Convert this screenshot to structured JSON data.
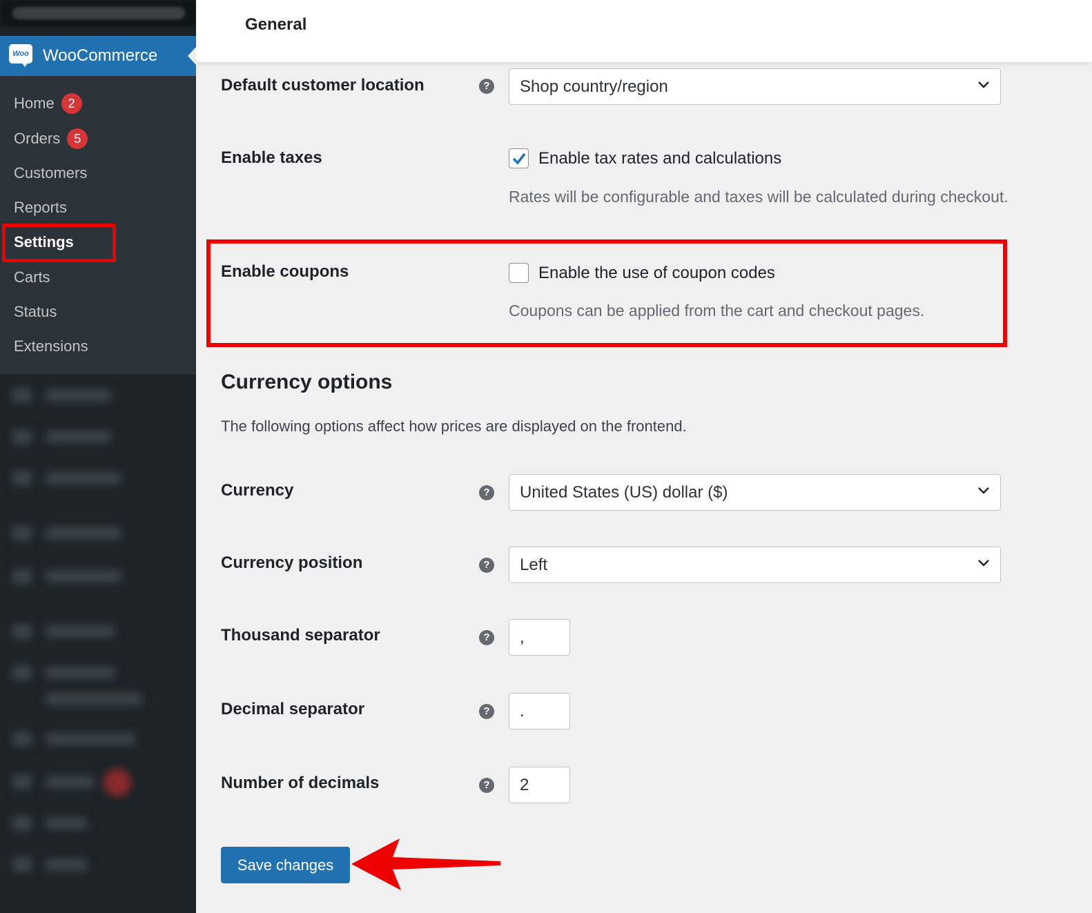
{
  "sidebar": {
    "brand": "WooCommerce",
    "logo_text": "Woo",
    "items": [
      {
        "label": "Home",
        "badge": "2"
      },
      {
        "label": "Orders",
        "badge": "5"
      },
      {
        "label": "Customers"
      },
      {
        "label": "Reports"
      },
      {
        "label": "Settings",
        "active": true
      },
      {
        "label": "Carts"
      },
      {
        "label": "Status"
      },
      {
        "label": "Extensions"
      }
    ]
  },
  "header": {
    "title": "General"
  },
  "fields": {
    "default_location": {
      "label": "Default customer location",
      "value": "Shop country/region"
    },
    "enable_taxes": {
      "label": "Enable taxes",
      "checkbox_label": "Enable tax rates and calculations",
      "checked": true,
      "description": "Rates will be configurable and taxes will be calculated during checkout."
    },
    "enable_coupons": {
      "label": "Enable coupons",
      "checkbox_label": "Enable the use of coupon codes",
      "checked": false,
      "description": "Coupons can be applied from the cart and checkout pages."
    }
  },
  "currency_options": {
    "heading": "Currency options",
    "description": "The following options affect how prices are displayed on the frontend.",
    "currency": {
      "label": "Currency",
      "value": "United States (US) dollar ($)"
    },
    "position": {
      "label": "Currency position",
      "value": "Left"
    },
    "thousand_sep": {
      "label": "Thousand separator",
      "value": ","
    },
    "decimal_sep": {
      "label": "Decimal separator",
      "value": "."
    },
    "num_decimals": {
      "label": "Number of decimals",
      "value": "2"
    }
  },
  "help_icon": "?",
  "save_label": "Save changes",
  "colors": {
    "accent": "#2271b1",
    "highlight": "#ee0000",
    "sidebar": "#1d2327",
    "badge": "#d63638"
  }
}
